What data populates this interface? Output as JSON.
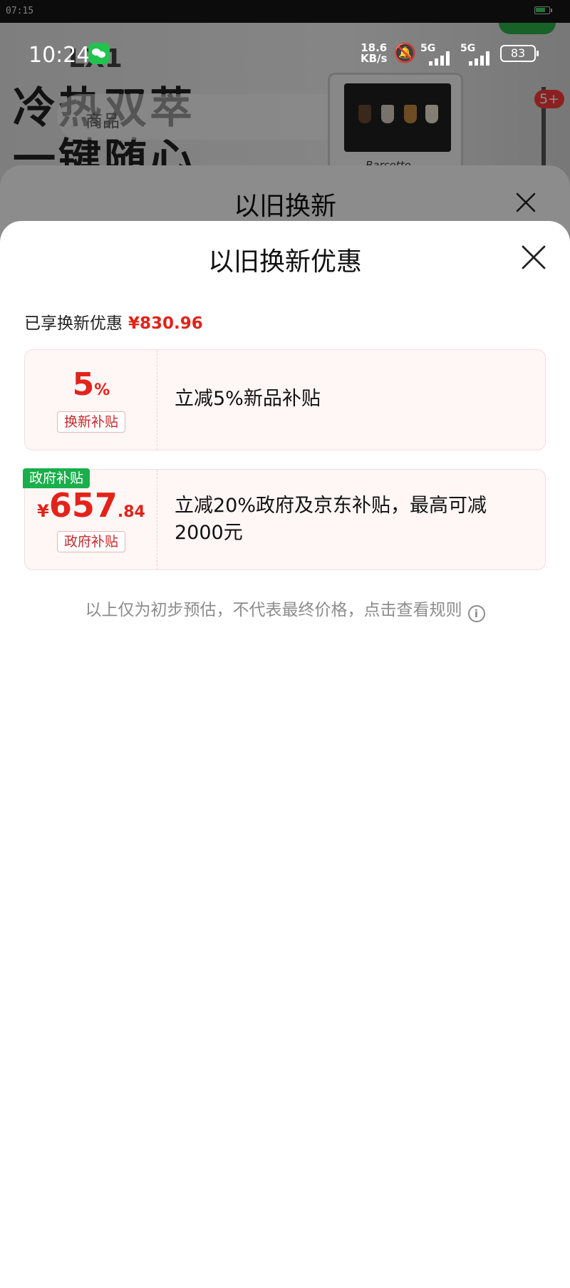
{
  "outer_status": {
    "time": "07:15"
  },
  "phone_status": {
    "time": "10:24",
    "net_speed_value": "18.6",
    "net_speed_unit": "KB/s",
    "signal_1": "5G",
    "signal_2": "5G",
    "battery": "83"
  },
  "background": {
    "model_text": "LX1",
    "slogan_line1": "冷热双萃",
    "slogan_line2": "一键随心",
    "search_text": "商品",
    "brand": "Barsetto",
    "badge": "5+"
  },
  "back_sheet": {
    "title": "以旧换新"
  },
  "sheet": {
    "title": "以旧换新优惠",
    "enjoyed_label": "已享换新优惠",
    "enjoyed_amount": "¥830.96",
    "cards": [
      {
        "big_value": "5",
        "big_unit": "%",
        "pill": "换新补贴",
        "desc": "立减5%新品补贴"
      },
      {
        "corner_tag": "政府补贴",
        "currency": "¥",
        "amount_int": "657",
        "amount_dec": ".84",
        "pill": "政府补贴",
        "desc": "立减20%政府及京东补贴，最高可减2000元"
      }
    ],
    "note": "以上仅为初步预估，不代表最终价格，点击查看规则"
  },
  "colors": {
    "accent_red": "#e2231a",
    "tag_green": "#1aae4c"
  }
}
